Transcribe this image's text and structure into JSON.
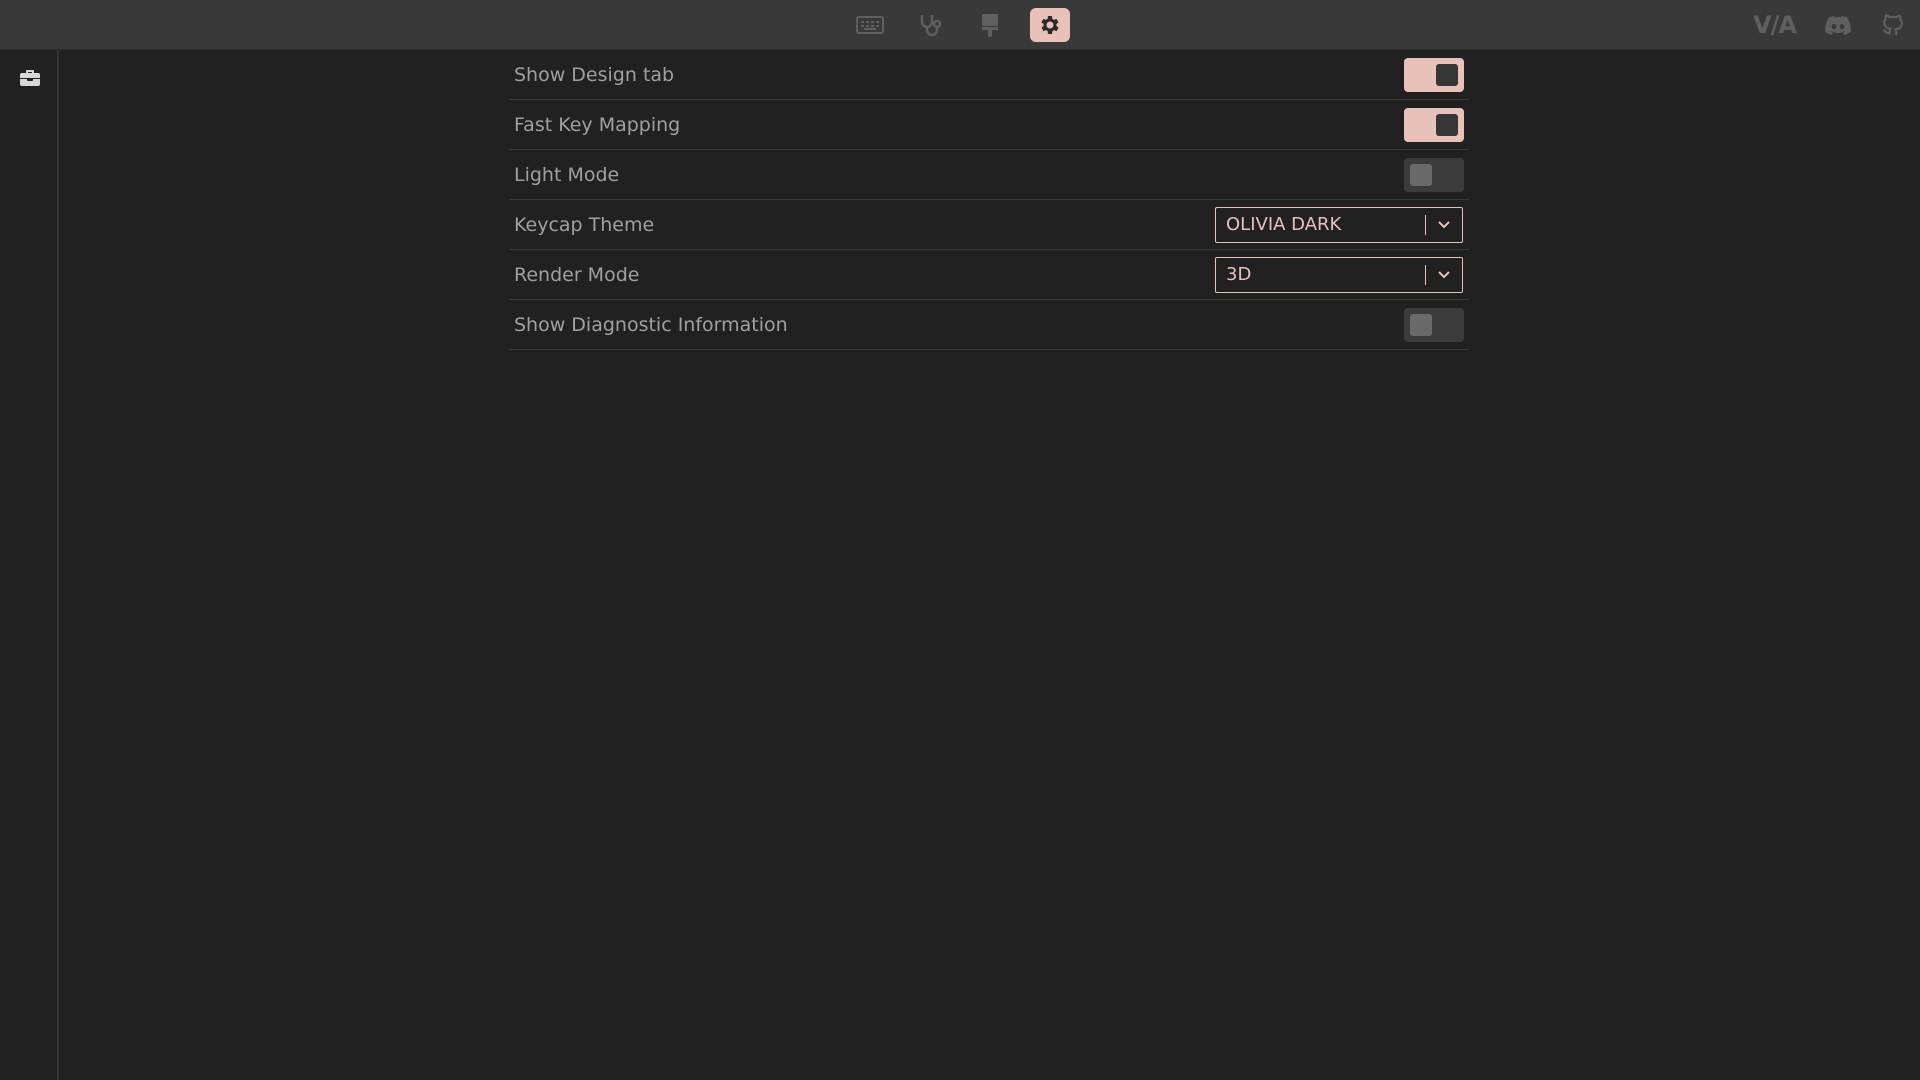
{
  "topbar": {
    "nav_items": [
      {
        "name": "keyboard-icon",
        "active": false
      },
      {
        "name": "stethoscope-icon",
        "active": false
      },
      {
        "name": "brush-icon",
        "active": false
      },
      {
        "name": "gear-icon",
        "active": true
      }
    ],
    "logo_text": "V/A",
    "right_icons": [
      "discord-icon",
      "github-icon"
    ]
  },
  "sidebar": {
    "items": [
      {
        "name": "toolbox-icon"
      }
    ]
  },
  "settings": {
    "rows": [
      {
        "label": "Show Design tab",
        "control": "toggle",
        "state": "on"
      },
      {
        "label": "Fast Key Mapping",
        "control": "toggle",
        "state": "on"
      },
      {
        "label": "Light Mode",
        "control": "toggle",
        "state": "off"
      },
      {
        "label": "Keycap Theme",
        "control": "select",
        "value": "OLIVIA DARK"
      },
      {
        "label": "Render Mode",
        "control": "select",
        "value": "3D"
      },
      {
        "label": "Show Diagnostic Information",
        "control": "toggle",
        "state": "off"
      }
    ]
  },
  "colors": {
    "accent": "#e8c2b8",
    "background": "#212121",
    "topbar": "#393939"
  }
}
